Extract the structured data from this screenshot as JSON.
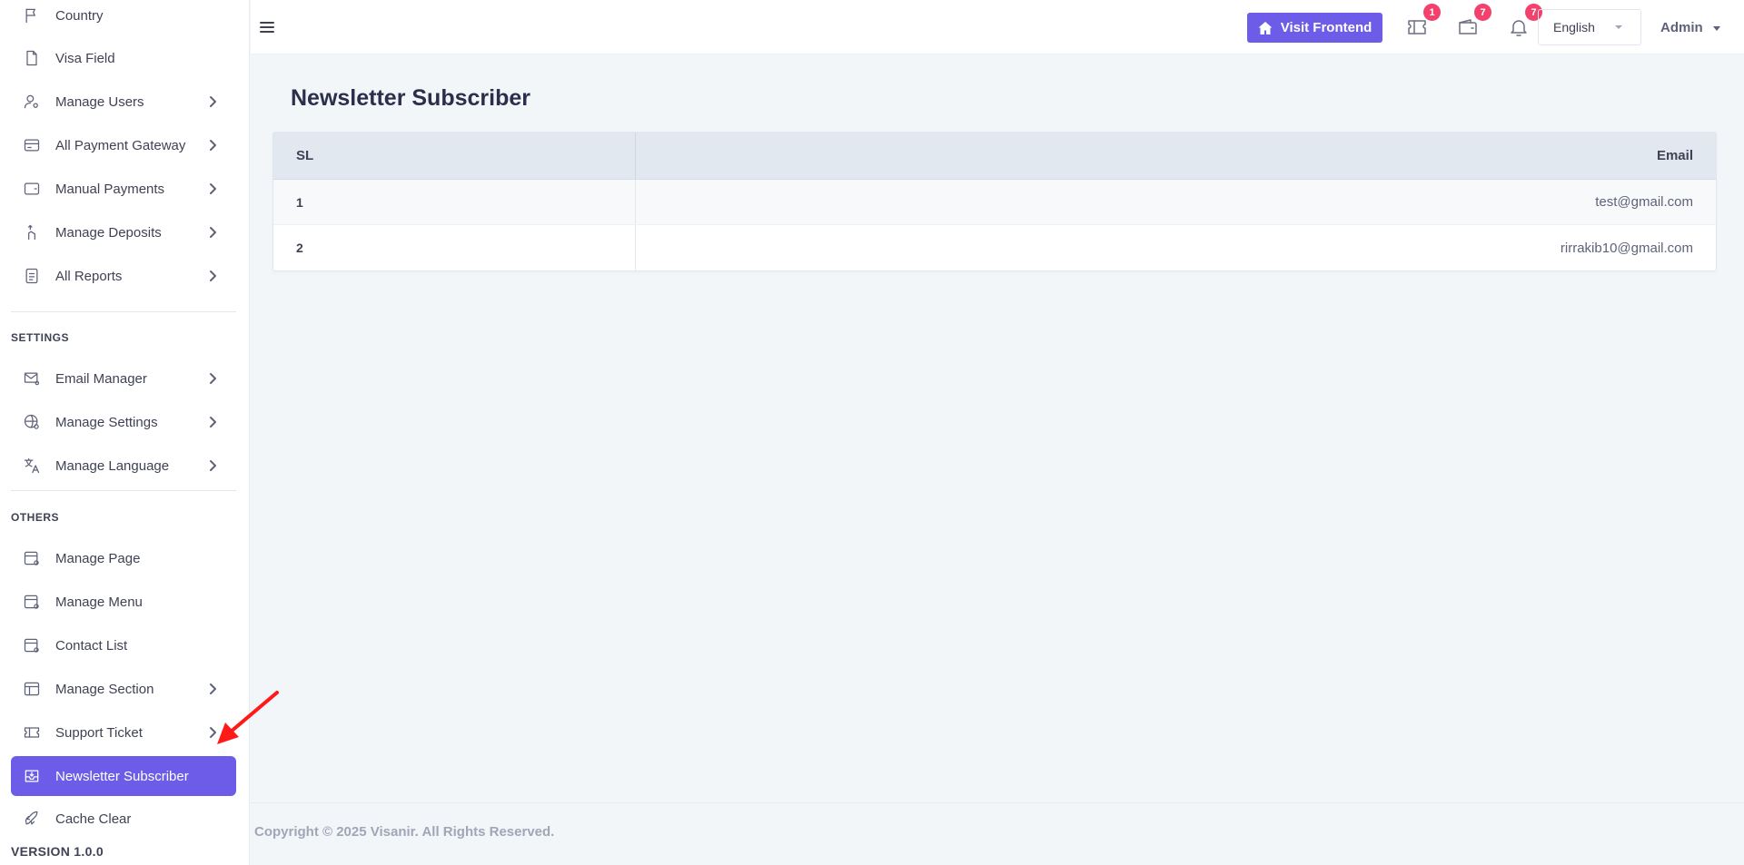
{
  "sidebar": {
    "items": [
      {
        "label": "Country",
        "icon": "flag-icon"
      },
      {
        "label": "Visa Field",
        "icon": "file-icon"
      },
      {
        "label": "Manage Users",
        "icon": "user-gear-icon"
      },
      {
        "label": "All Payment Gateway",
        "icon": "credit-card-icon"
      },
      {
        "label": "Manual Payments",
        "icon": "wallet-icon"
      },
      {
        "label": "Manage Deposits",
        "icon": "deposit-hand-icon"
      },
      {
        "label": "All Reports",
        "icon": "report-icon"
      }
    ],
    "settings_label": "SETTINGS",
    "settings_items": [
      {
        "label": "Email Manager",
        "icon": "mail-gear-icon"
      },
      {
        "label": "Manage Settings",
        "icon": "globe-gear-icon"
      },
      {
        "label": "Manage Language",
        "icon": "translate-icon"
      }
    ],
    "others_label": "OTHERS",
    "others_items": [
      {
        "label": "Manage Page",
        "icon": "page-gear-icon"
      },
      {
        "label": "Manage Menu",
        "icon": "menu-gear-icon"
      },
      {
        "label": "Contact List",
        "icon": "contact-gear-icon"
      },
      {
        "label": "Manage Section",
        "icon": "layout-icon"
      },
      {
        "label": "Support Ticket",
        "icon": "ticket-icon"
      },
      {
        "label": "Newsletter Subscriber",
        "icon": "inbox-icon"
      },
      {
        "label": "Cache Clear",
        "icon": "rocket-icon"
      }
    ],
    "version": "VERSION 1.0.0"
  },
  "topbar": {
    "visit_label": "Visit Frontend",
    "ticket_badge": "1",
    "wallet_badge": "7",
    "bell_badge": "7",
    "language": "English",
    "user": "Admin"
  },
  "page": {
    "title": "Newsletter Subscriber",
    "table": {
      "headers": [
        "SL",
        "Email"
      ],
      "rows": [
        [
          "1",
          "test@gmail.com"
        ],
        [
          "2",
          "rirrakib10@gmail.com"
        ]
      ]
    },
    "copyright": "Copyright © 2025 Visanir. All Rights Reserved."
  },
  "colors": {
    "accent": "#6c5ce7",
    "badge": "#f1416c",
    "annotation_arrow": "#ff0000"
  }
}
